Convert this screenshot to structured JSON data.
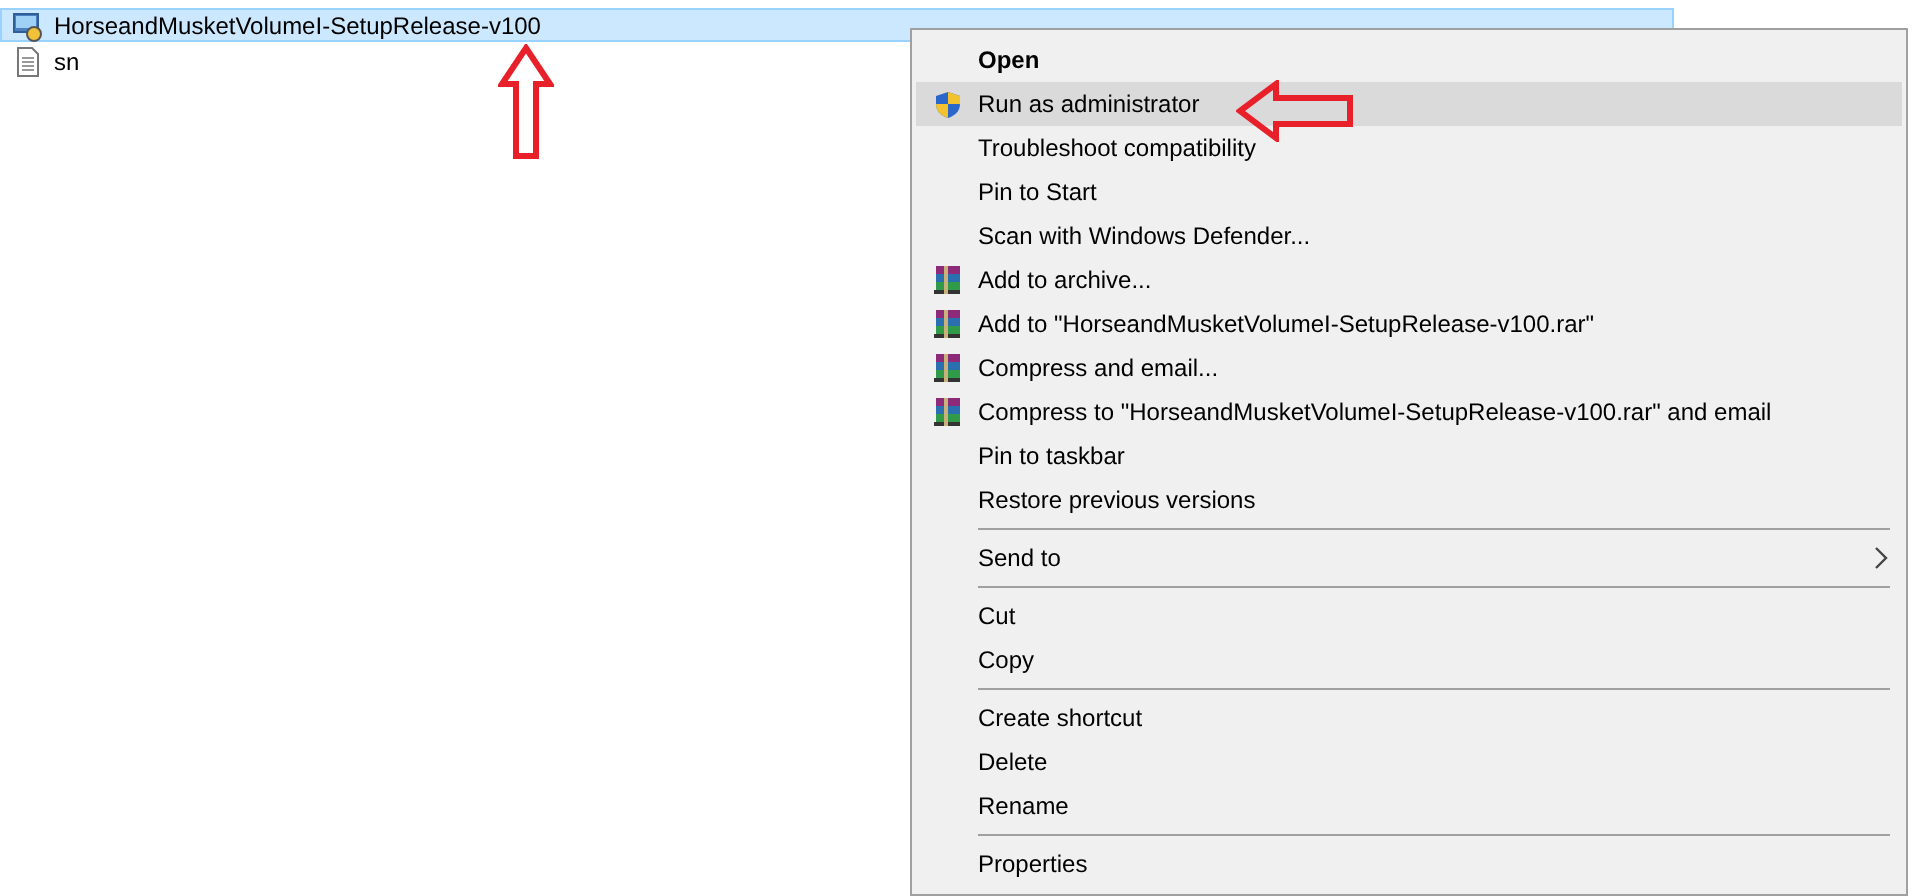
{
  "file_list": {
    "rows": [
      {
        "name": "HorseandMusketVolumeI-SetupRelease-v100",
        "kind": "application",
        "selected": true
      },
      {
        "name": "sn",
        "kind": "document",
        "selected": false
      }
    ]
  },
  "context_menu": {
    "items": [
      {
        "kind": "item",
        "label": "Open",
        "bold": true,
        "selected": false
      },
      {
        "kind": "shield_item",
        "label": "Run as administrator",
        "bold": false,
        "selected": true
      },
      {
        "kind": "item",
        "label": "Troubleshoot compatibility",
        "bold": false,
        "selected": false
      },
      {
        "kind": "item",
        "label": "Pin to Start",
        "bold": false,
        "selected": false
      },
      {
        "kind": "item",
        "label": "Scan with Windows Defender...",
        "bold": false,
        "selected": false
      },
      {
        "kind": "archive_item",
        "label": "Add to archive...",
        "bold": false,
        "selected": false
      },
      {
        "kind": "archive_item",
        "label": "Add to \"HorseandMusketVolumeI-SetupRelease-v100.rar\"",
        "bold": false,
        "selected": false
      },
      {
        "kind": "archive_item",
        "label": "Compress and email...",
        "bold": false,
        "selected": false
      },
      {
        "kind": "archive_item",
        "label": "Compress to \"HorseandMusketVolumeI-SetupRelease-v100.rar\" and email",
        "bold": false,
        "selected": false
      },
      {
        "kind": "item",
        "label": "Pin to taskbar",
        "bold": false,
        "selected": false
      },
      {
        "kind": "item",
        "label": "Restore previous versions",
        "bold": false,
        "selected": false
      },
      {
        "kind": "separator"
      },
      {
        "kind": "submenu",
        "label": "Send to",
        "bold": false,
        "selected": false
      },
      {
        "kind": "separator"
      },
      {
        "kind": "item",
        "label": "Cut",
        "bold": false,
        "selected": false
      },
      {
        "kind": "item",
        "label": "Copy",
        "bold": false,
        "selected": false
      },
      {
        "kind": "separator"
      },
      {
        "kind": "item",
        "label": "Create shortcut",
        "bold": false,
        "selected": false
      },
      {
        "kind": "item",
        "label": "Delete",
        "bold": false,
        "selected": false
      },
      {
        "kind": "item",
        "label": "Rename",
        "bold": false,
        "selected": false
      },
      {
        "kind": "separator"
      },
      {
        "kind": "item",
        "label": "Properties",
        "bold": false,
        "selected": false
      }
    ]
  }
}
